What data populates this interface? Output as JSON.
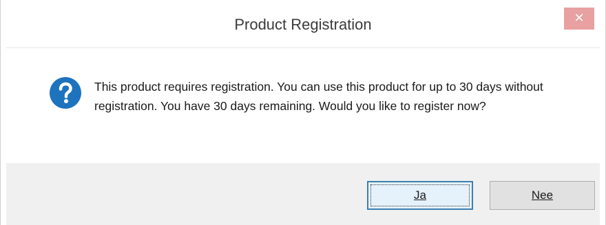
{
  "window": {
    "title": "Product Registration",
    "close_glyph": "✕"
  },
  "message": {
    "icon": "question-icon",
    "text": "This product requires registration. You can use this product for up to 30 days without registration. You have 30 days remaining. Would you like to register now?"
  },
  "buttons": {
    "yes_label": "Ja",
    "no_label": "Nee"
  },
  "colors": {
    "icon_blue": "#1e73be",
    "close_button": "#e8a0a0",
    "default_button_border": "#3c7fb1"
  }
}
